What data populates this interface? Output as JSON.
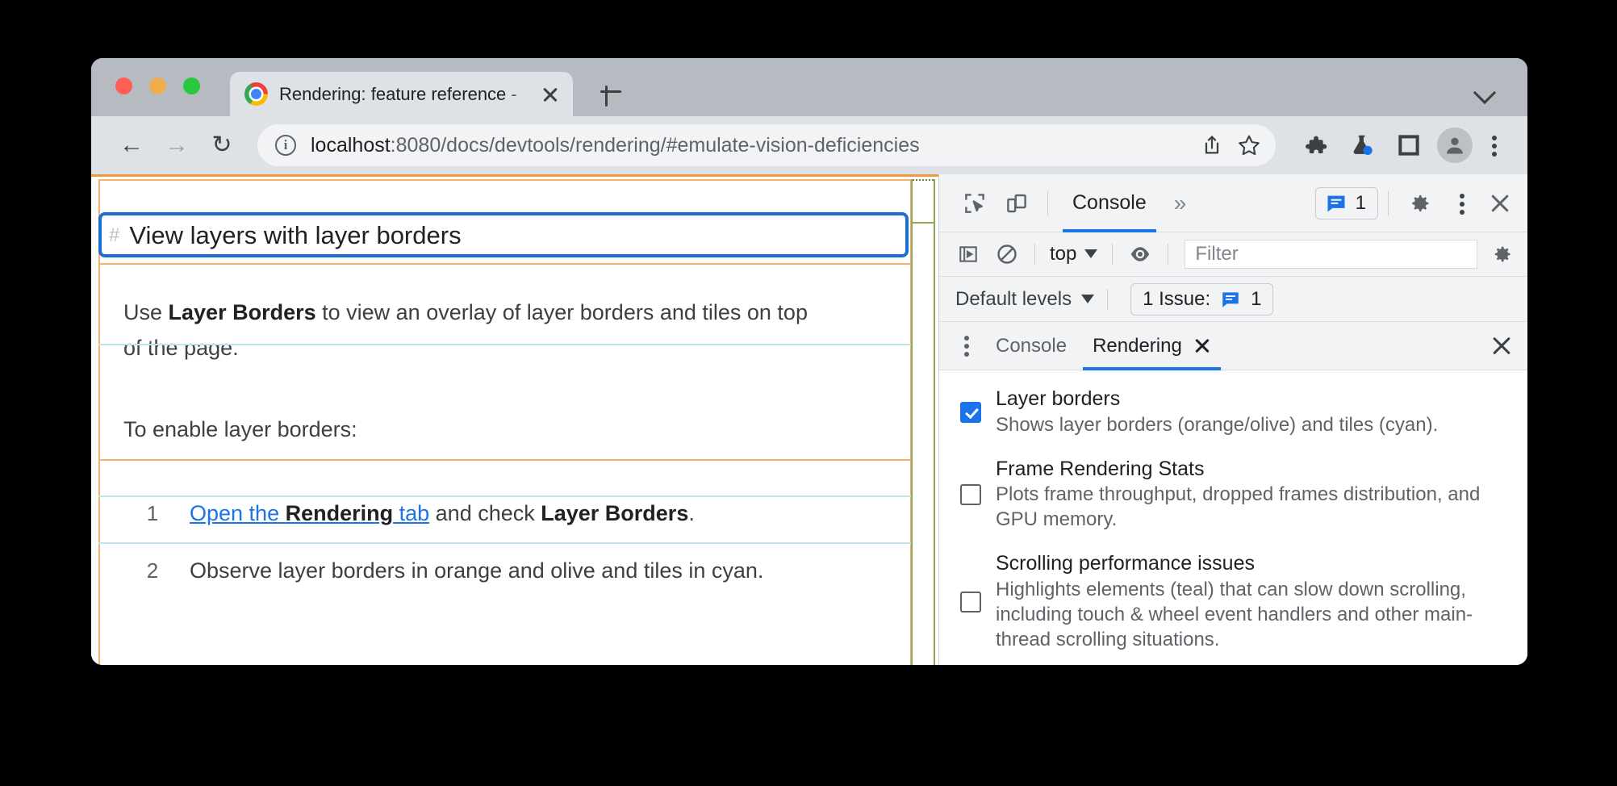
{
  "window": {
    "traffic_lights": [
      "close",
      "minimize",
      "maximize"
    ],
    "colors": {
      "close": "#ff5f57",
      "minimize": "#f0ad4e",
      "maximize": "#28c840",
      "accent": "#1a73e8"
    }
  },
  "tab": {
    "title": "Rendering: feature reference -",
    "close_label": "×",
    "new_tab_label": "+"
  },
  "nav": {
    "back": "←",
    "forward": "→",
    "reload": "↻",
    "url_host": "localhost",
    "url_rest": ":8080/docs/devtools/rendering/#emulate-vision-deficiencies"
  },
  "page": {
    "heading_hash": "#",
    "heading": "View layers with layer borders",
    "paragraph1_pre": "Use ",
    "paragraph1_bold": "Layer Borders",
    "paragraph1_post": " to view an overlay of layer borders and tiles on top of the page.",
    "paragraph2": "To enable layer borders:",
    "steps": [
      {
        "num": "1",
        "link_pre": "Open the ",
        "link_bold": "Rendering",
        "link_post": " tab",
        "after_pre": " and check ",
        "after_bold": "Layer Borders",
        "after_post": "."
      },
      {
        "num": "2",
        "plain": "Observe layer borders in orange and olive and tiles in cyan."
      }
    ],
    "layer_border_colors": {
      "layer": "#f5b06a",
      "composited": "#1a6fd4",
      "tile": "#bfe4ec",
      "scroll": "#8fa85a"
    }
  },
  "devtools": {
    "toolbar": {
      "tabs": [
        {
          "label": "Console",
          "active": true
        }
      ],
      "overflow_label": "»",
      "issue_count": "1"
    },
    "filterbar": {
      "context": "top",
      "filter_placeholder": "Filter"
    },
    "levelbar": {
      "levels_label": "Default levels",
      "issue_label": "1 Issue:",
      "issue_count": "1"
    },
    "drawer": {
      "tabs": [
        {
          "label": "Console",
          "active": false,
          "closable": false
        },
        {
          "label": "Rendering",
          "active": true,
          "closable": true
        }
      ]
    },
    "rendering_options": [
      {
        "title": "Layer borders",
        "desc": "Shows layer borders (orange/olive) and tiles (cyan).",
        "checked": true
      },
      {
        "title": "Frame Rendering Stats",
        "desc": "Plots frame throughput, dropped frames distribution, and GPU memory.",
        "checked": false
      },
      {
        "title": "Scrolling performance issues",
        "desc": "Highlights elements (teal) that can slow down scrolling, including touch & wheel event handlers and other main-thread scrolling situations.",
        "checked": false
      }
    ]
  }
}
